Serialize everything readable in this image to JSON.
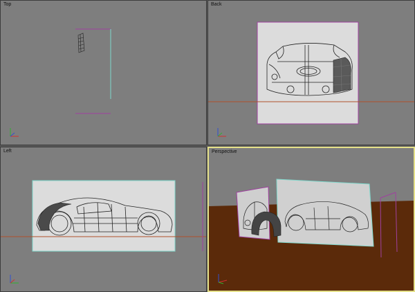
{
  "viewports": {
    "top": {
      "label": "Top"
    },
    "back": {
      "label": "Back"
    },
    "left": {
      "label": "Left"
    },
    "perspective": {
      "label": "Perspective"
    }
  },
  "colors": {
    "viewport_bg": "#7e7e7e",
    "active_border": "#e5e18a",
    "ground": "#5b2a0a",
    "plane": "#dcdcdc",
    "magenta_edge": "#a040a0",
    "cyan_edge": "#7fd8cc",
    "horizon_line": "#b0502a"
  },
  "axis_gizmo": {
    "x_color": "#d03030",
    "y_color": "#30b030",
    "z_color": "#3050d0"
  }
}
